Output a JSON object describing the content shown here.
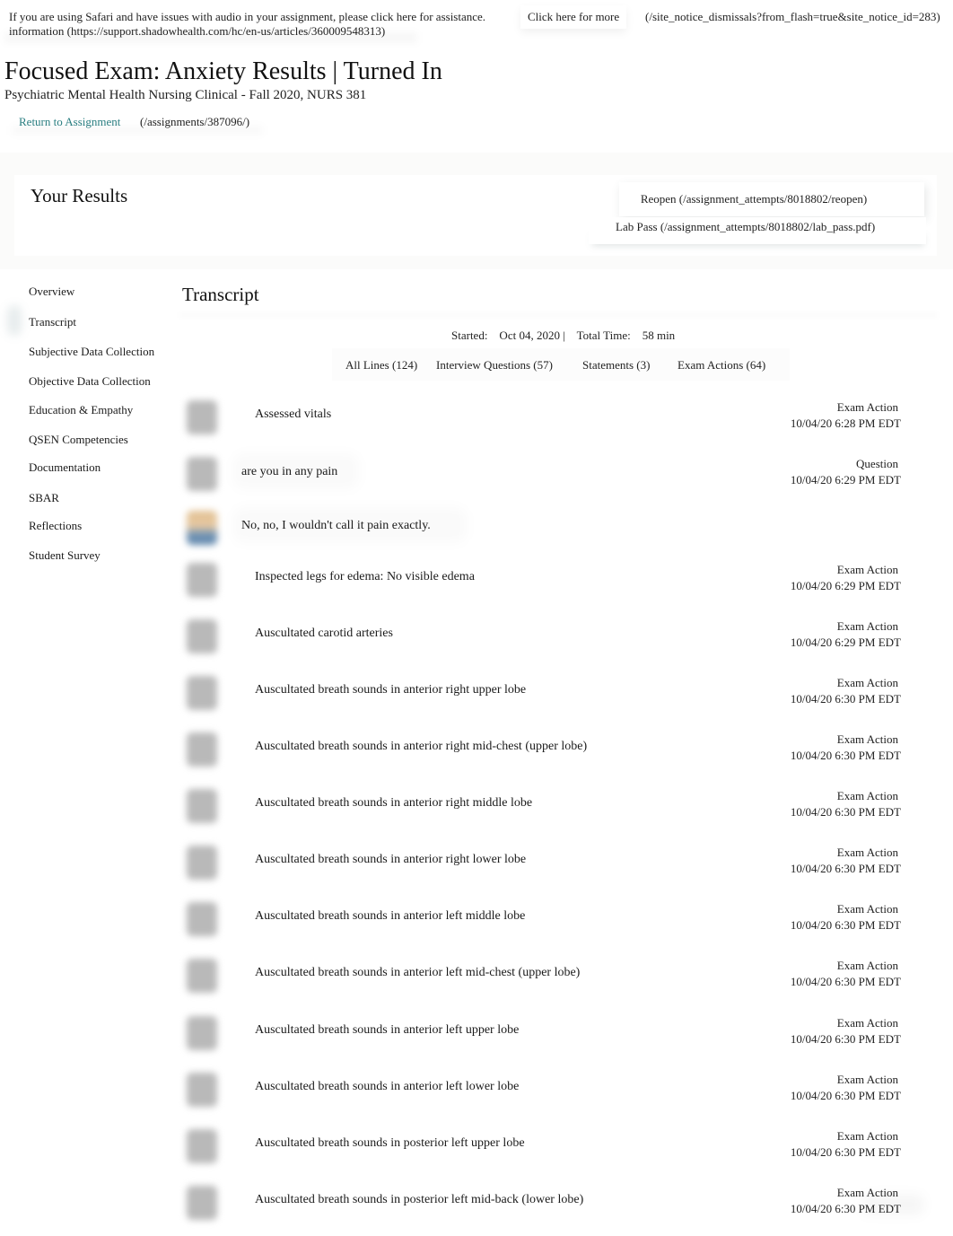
{
  "notice": {
    "text": "If you are using Safari and have issues with audio in your assignment, please click here for assistance. information  (https://support.shadowhealth.com/hc/en-us/articles/360009548313)",
    "more_label": "Click here for more",
    "dismiss_url": "(/site_notice_dismissals?from_flash=true&site_notice_id=283)"
  },
  "header": {
    "title": "Focused Exam: Anxiety Results | Turned In",
    "subtitle": "Psychiatric Mental Health Nursing Clinical - Fall 2020, NURS 381",
    "return_label": "Return to Assignment",
    "return_url": "(/assignments/387096/)"
  },
  "results": {
    "title": "Your Results",
    "reopen_label": "Reopen (/assignment_attempts/8018802/reopen)",
    "labpass_label": "Lab Pass (/assignment_attempts/8018802/lab_pass.pdf)"
  },
  "sidebar": {
    "active": "Transcript",
    "items": [
      {
        "label": "Overview"
      },
      {
        "label": "Transcript"
      },
      {
        "label": "Subjective Data Collection"
      },
      {
        "label": "Objective Data Collection"
      },
      {
        "label": "Education & Empathy"
      },
      {
        "label": "QSEN Competencies"
      },
      {
        "label": "Documentation"
      },
      {
        "label": "SBAR"
      },
      {
        "label": "Reflections"
      },
      {
        "label": "Student Survey"
      }
    ]
  },
  "transcript": {
    "title": "Transcript",
    "meta": "Started:    Oct 04, 2020 |    Total Time:    58 min",
    "filters": [
      {
        "label": "All Lines (124)"
      },
      {
        "label": "Interview Questions (57)"
      },
      {
        "label": "Statements (3)"
      },
      {
        "label": "Exam Actions (64)"
      }
    ],
    "rows": [
      {
        "speaker": "student",
        "kind": "exam",
        "text": "Assessed vitals",
        "type": "Exam Action",
        "time": "10/04/20 6:28 PM EDT"
      },
      {
        "speaker": "student",
        "kind": "question",
        "text": "are you in any pain",
        "type": "Question",
        "time": "10/04/20 6:29 PM EDT"
      },
      {
        "speaker": "patient",
        "kind": "statement",
        "text": "No, no, I wouldn't call it pain exactly.",
        "type": "",
        "time": ""
      },
      {
        "speaker": "student",
        "kind": "exam",
        "text": "Inspected legs for edema: No visible edema",
        "type": "Exam Action",
        "time": "10/04/20 6:29 PM EDT"
      },
      {
        "speaker": "student",
        "kind": "exam",
        "text": "Auscultated carotid arteries",
        "type": "Exam Action",
        "time": "10/04/20 6:29 PM EDT"
      },
      {
        "speaker": "student",
        "kind": "exam",
        "text": "Auscultated breath sounds in anterior right upper lobe",
        "type": "Exam Action",
        "time": "10/04/20 6:30 PM EDT"
      },
      {
        "speaker": "student",
        "kind": "exam",
        "text": "Auscultated breath sounds in anterior right mid-chest (upper lobe)",
        "type": "Exam Action",
        "time": "10/04/20 6:30 PM EDT"
      },
      {
        "speaker": "student",
        "kind": "exam",
        "text": "Auscultated breath sounds in anterior right middle lobe",
        "type": "Exam Action",
        "time": "10/04/20 6:30 PM EDT"
      },
      {
        "speaker": "student",
        "kind": "exam",
        "text": "Auscultated breath sounds in anterior right lower lobe",
        "type": "Exam Action",
        "time": "10/04/20 6:30 PM EDT"
      },
      {
        "speaker": "student",
        "kind": "exam",
        "text": "Auscultated breath sounds in anterior left middle lobe",
        "type": "Exam Action",
        "time": "10/04/20 6:30 PM EDT"
      },
      {
        "speaker": "student",
        "kind": "exam",
        "text": "Auscultated breath sounds in anterior left mid-chest (upper lobe)",
        "type": "Exam Action",
        "time": "10/04/20 6:30 PM EDT"
      },
      {
        "speaker": "student",
        "kind": "exam",
        "text": "Auscultated breath sounds in anterior left upper lobe",
        "type": "Exam Action",
        "time": "10/04/20 6:30 PM EDT"
      },
      {
        "speaker": "student",
        "kind": "exam",
        "text": "Auscultated breath sounds in anterior left lower lobe",
        "type": "Exam Action",
        "time": "10/04/20 6:30 PM EDT"
      },
      {
        "speaker": "student",
        "kind": "exam",
        "text": "Auscultated breath sounds in posterior left upper lobe",
        "type": "Exam Action",
        "time": "10/04/20 6:30 PM EDT"
      },
      {
        "speaker": "student",
        "kind": "exam",
        "text": "Auscultated breath sounds in posterior left mid-back (lower lobe)",
        "type": "Exam Action",
        "time": "10/04/20 6:30 PM EDT"
      }
    ]
  },
  "colors": {
    "link": "#2a7f82",
    "text": "#1a1a1a",
    "avatar_student": "#b9b9b9"
  }
}
